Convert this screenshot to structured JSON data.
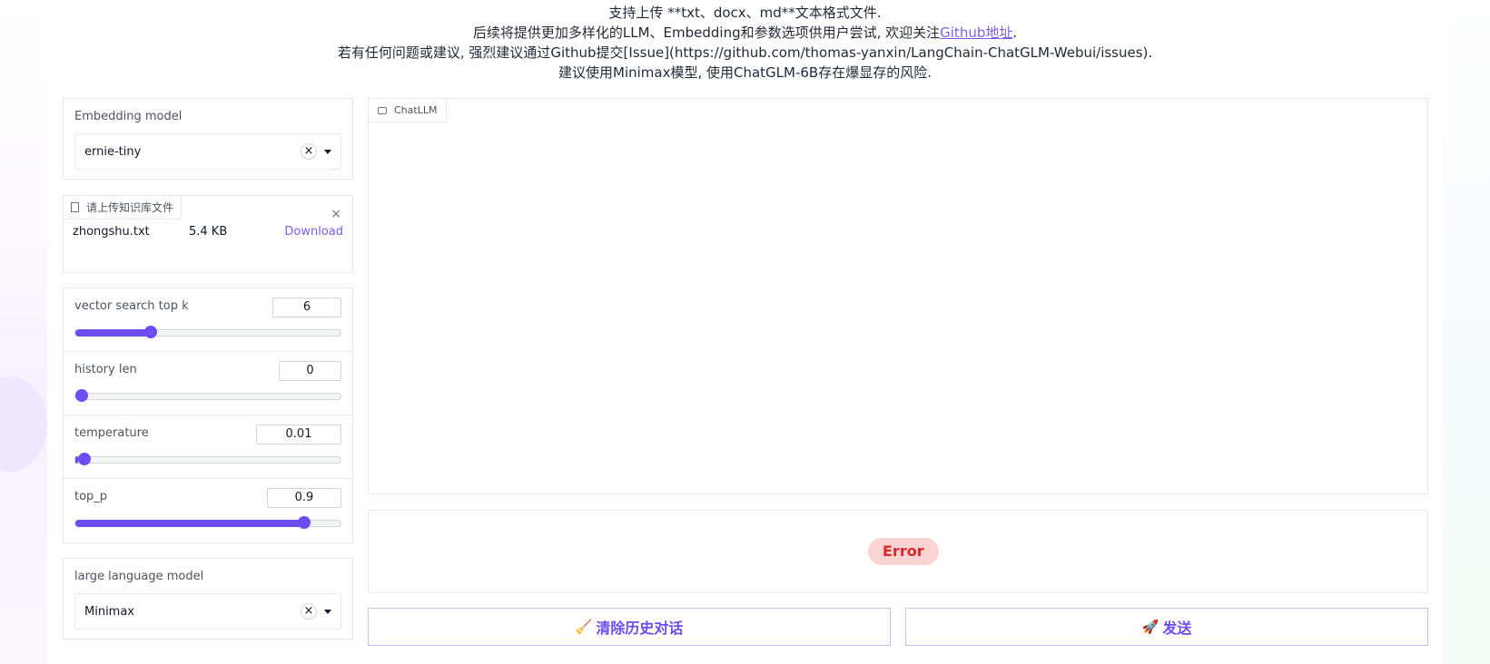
{
  "intro": {
    "line1": "支持上传 **txt、docx、md**文本格式文件.",
    "line2_prefix": "后续将提供更加多样化的LLM、Embedding和参数选项供用户尝试, 欢迎关注",
    "line2_link": "Github地址",
    "line2_suffix": ".",
    "line3": "若有任何问题或建议, 强烈建议通过Github提交[Issue](https://github.com/thomas-yanxin/LangChain-ChatGLM-Webui/issues).",
    "line4": "建议使用Minimax模型, 使用ChatGLM-6B存在爆显存的风险."
  },
  "embedding": {
    "label": "Embedding model",
    "value": "ernie-tiny",
    "clear_symbol": "×"
  },
  "upload": {
    "tab_label": "请上传知识库文件",
    "close_symbol": "×",
    "file_name": "zhongshu.txt",
    "file_size": "5.4 KB",
    "download_label": "Download"
  },
  "sliders": [
    {
      "label": "vector search top k",
      "value": "6",
      "fraction": 0.275
    },
    {
      "label": "history len",
      "value": "0",
      "fraction": 0.0
    },
    {
      "label": "temperature",
      "value": "0.01",
      "fraction": 0.01
    },
    {
      "label": "top_p",
      "value": "0.9",
      "fraction": 0.88
    }
  ],
  "llm": {
    "label": "large language model",
    "value": "Minimax",
    "clear_symbol": "×"
  },
  "chat": {
    "tab_label": "ChatLLM"
  },
  "status": {
    "error_label": "Error"
  },
  "actions": {
    "clear_icon": "🧹",
    "clear_label": "清除历史对话",
    "send_icon": "🚀",
    "send_label": "发送"
  },
  "colors": {
    "accent": "#6d4cf0",
    "error_bg": "#fcd3d3",
    "error_text": "#dc2626"
  }
}
